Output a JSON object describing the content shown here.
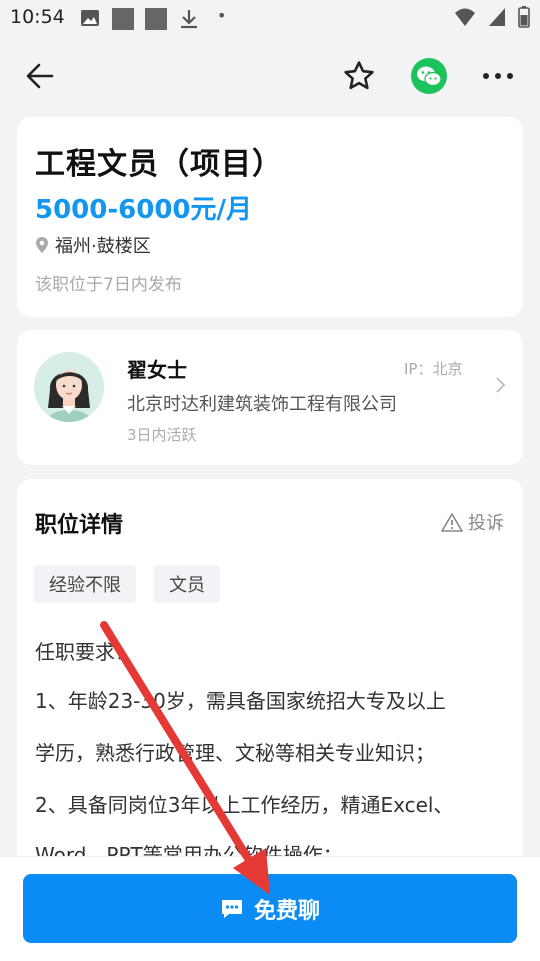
{
  "status_bar": {
    "time": "10:54",
    "dot": "•"
  },
  "nav": {
    "back_icon": "back-arrow-icon",
    "favorite_icon": "star-icon",
    "share_icon": "wechat-icon",
    "more_icon": "more-icon"
  },
  "job": {
    "title": "工程文员（项目）",
    "salary": "5000-6000元/月",
    "location": "福州·鼓楼区",
    "posted": "该职位于7日内发布"
  },
  "recruiter": {
    "name": "翟女士",
    "ip": "IP：北京",
    "company": "北京时达利建筑装饰工程有限公司",
    "active": "3日内活跃"
  },
  "detail": {
    "title": "职位详情",
    "report_label": "投诉",
    "tags": [
      "经验不限",
      "文员"
    ],
    "lines": [
      "任职要求：",
      "1、年龄23-30岁，需具备国家统招大专及以上",
      "学历，熟悉行政管理、文秘等相关专业知识；",
      "2、具备同岗位3年以上工作经历，精通Excel、",
      "Word、PPT等常用办公软件操作；"
    ]
  },
  "action": {
    "chat_label": "免费聊"
  },
  "colors": {
    "accent": "#0b8cf5",
    "salary": "#1296f0",
    "wechat": "#1bc35a",
    "annotation_arrow": "#e53935"
  }
}
